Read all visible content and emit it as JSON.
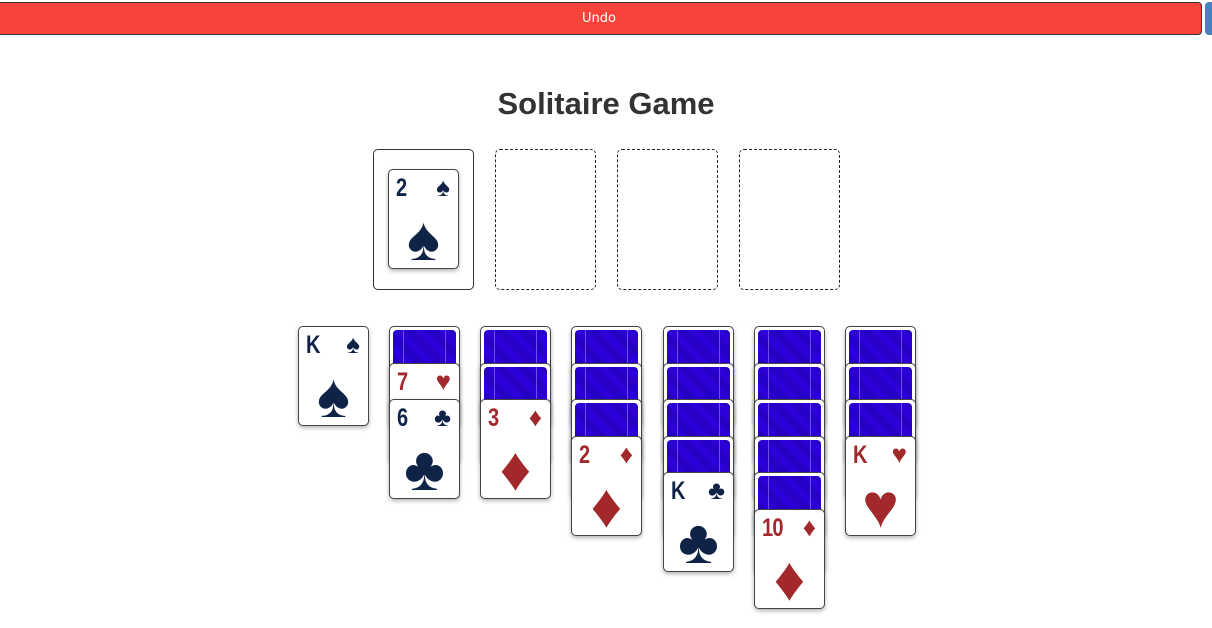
{
  "toolbar": {
    "undo_label": "Undo"
  },
  "title": "Solitaire Game",
  "colors": {
    "black_suit": "#0f2346",
    "red_suit": "#a3282c",
    "card_back": "#2a00d0",
    "undo": "#f7433a"
  },
  "stock": {
    "top_card": {
      "rank": "2",
      "suit": "spades",
      "symbol": "♠"
    }
  },
  "foundations": [
    {
      "cards": []
    },
    {
      "cards": []
    },
    {
      "cards": []
    }
  ],
  "tableau": [
    {
      "hidden": 0,
      "up": [
        {
          "rank": "K",
          "suit": "spades",
          "symbol": "♠"
        }
      ]
    },
    {
      "hidden": 1,
      "up": [
        {
          "rank": "7",
          "suit": "hearts",
          "symbol": "♥"
        },
        {
          "rank": "6",
          "suit": "clubs",
          "symbol": "♣"
        }
      ]
    },
    {
      "hidden": 2,
      "up": [
        {
          "rank": "3",
          "suit": "diamonds",
          "symbol": "♦"
        }
      ]
    },
    {
      "hidden": 3,
      "up": [
        {
          "rank": "2",
          "suit": "diamonds",
          "symbol": "♦"
        }
      ]
    },
    {
      "hidden": 4,
      "up": [
        {
          "rank": "K",
          "suit": "clubs",
          "symbol": "♣"
        }
      ]
    },
    {
      "hidden": 5,
      "up": [
        {
          "rank": "10",
          "suit": "diamonds",
          "symbol": "♦"
        }
      ]
    },
    {
      "hidden": 3,
      "up": [
        {
          "rank": "K",
          "suit": "hearts",
          "symbol": "♥"
        }
      ]
    }
  ]
}
